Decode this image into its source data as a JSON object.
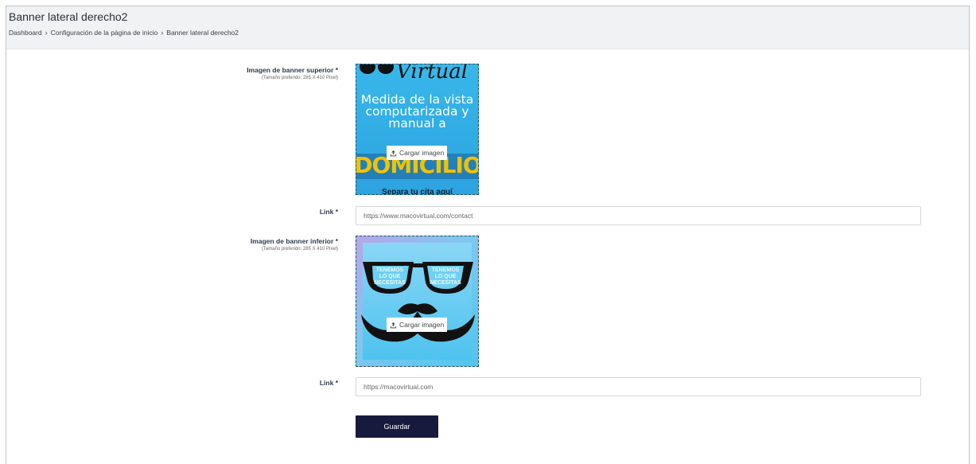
{
  "header": {
    "title": "Banner lateral derecho2",
    "breadcrumb": [
      "Dashboard",
      "Configuración de la página de inicio",
      "Banner lateral derecho2"
    ]
  },
  "form": {
    "top_banner": {
      "label": "Imagen de banner superior",
      "required": "*",
      "hint": "(Tamaño preferido: 285 X 410 Pixel)",
      "upload_label": "Cargar imagen",
      "image_text": {
        "brand": "Virtual",
        "message": [
          "Medida de la vista",
          "computarizada y",
          "manual a"
        ],
        "highlight": "DOMICILIO",
        "footer": "Separa tu cita aquí"
      }
    },
    "top_link": {
      "label": "Link",
      "required": "*",
      "value": "https://www.macovirtual.com/contact"
    },
    "bottom_banner": {
      "label": "Imagen de banner inferior",
      "required": "*",
      "hint": "(Tamaño preferido: 285 X 410 Pixel)",
      "upload_label": "Cargar imagen",
      "image_text": {
        "left_lens": [
          "TENEMOS",
          "LO QUE",
          "NECESITAS"
        ],
        "right_lens": [
          "TENEMOS",
          "LO QUE",
          "NECESITAS"
        ]
      }
    },
    "bottom_link": {
      "label": "Link",
      "required": "*",
      "value": "https://macovirtual.com"
    },
    "save_label": "Guardar"
  },
  "icons": {
    "upload": "upload-icon",
    "breadcrumb_separator": "chevron-right-icon"
  },
  "colors": {
    "save_button": "#161a3c",
    "header_bg": "#f1f2f4",
    "label": "#2c3a4f"
  }
}
